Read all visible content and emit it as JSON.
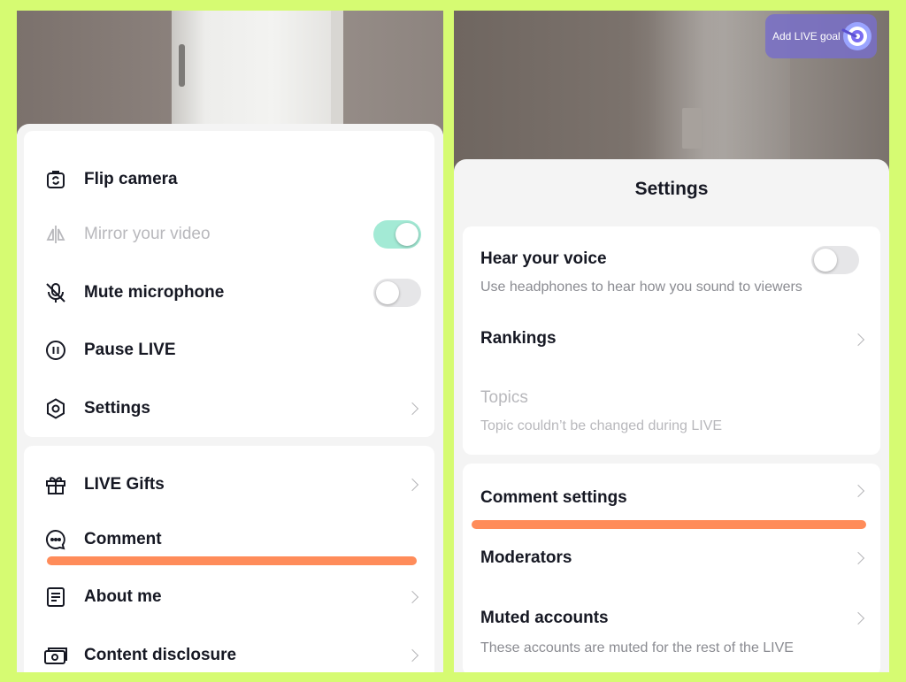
{
  "left": {
    "menu": [
      {
        "icon": "flip-camera-icon",
        "label": "Flip camera"
      },
      {
        "icon": "mirror-icon",
        "label": "Mirror your video",
        "toggle": "on",
        "disabled": true
      },
      {
        "icon": "mute-microphone-icon",
        "label": "Mute microphone",
        "toggle": "off"
      },
      {
        "icon": "pause-icon",
        "label": "Pause LIVE"
      },
      {
        "icon": "settings-hexagon-icon",
        "label": "Settings",
        "chevron": true
      }
    ],
    "menu2": [
      {
        "icon": "gift-icon",
        "label": "LIVE Gifts",
        "chevron": true
      },
      {
        "icon": "comment-icon",
        "label": "Comment"
      },
      {
        "icon": "about-me-icon",
        "label": "About me",
        "chevron": true
      },
      {
        "icon": "content-disclosure-icon",
        "label": "Content disclosure",
        "chevron": true
      }
    ]
  },
  "right": {
    "live_goal_label": "Add LIVE goal",
    "title": "Settings",
    "items": [
      {
        "label": "Hear your voice",
        "sub": "Use headphones to hear how you sound to viewers",
        "toggle": "off"
      },
      {
        "label": "Rankings",
        "chevron": true
      },
      {
        "label": "Topics",
        "sub": "Topic couldn’t be changed during LIVE",
        "disabled": true
      }
    ],
    "items2": [
      {
        "label": "Comment settings",
        "chevron": true
      },
      {
        "label": "Moderators",
        "chevron": true
      },
      {
        "label": "Muted accounts",
        "sub": "These accounts are muted for the rest of the LIVE",
        "chevron": true
      }
    ]
  },
  "colors": {
    "background": "#d6fb72",
    "highlight": "#ff8c5a",
    "toggle_on": "#a3ead5"
  }
}
